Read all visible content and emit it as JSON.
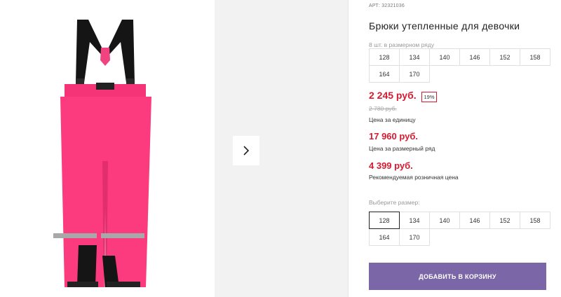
{
  "product": {
    "article_label": "АРТ:",
    "article": "32321036",
    "title": "Брюки утепленные для девочки",
    "pack_label": "8 шт. в размерном ряду",
    "pack_sizes": [
      "128",
      "134",
      "140",
      "146",
      "152",
      "158",
      "164",
      "170"
    ],
    "price": "2 245 руб.",
    "discount": "19%",
    "old_price": "2 780 руб.",
    "unit_price_label": "Цена за единицу",
    "row_price": "17 960 руб.",
    "row_price_label": "Цена за размерный ряд",
    "rrp": "4 399 руб.",
    "rrp_label": "Рекомендуемая розничная цена",
    "choose_size_label": "Выберите размер:",
    "choose_sizes": [
      "128",
      "134",
      "140",
      "146",
      "152",
      "158",
      "164",
      "170"
    ],
    "selected_size": "128",
    "add_to_cart": "ДОБАВИТЬ В КОРЗИНУ"
  },
  "gallery": {
    "image_icon": "pink-snow-pants-image",
    "next_icon": "chevron-right-icon"
  },
  "colors": {
    "price": "#d8192f",
    "button": "#7b67a7",
    "pants": "#fb3b7d",
    "straps": "#111111"
  }
}
